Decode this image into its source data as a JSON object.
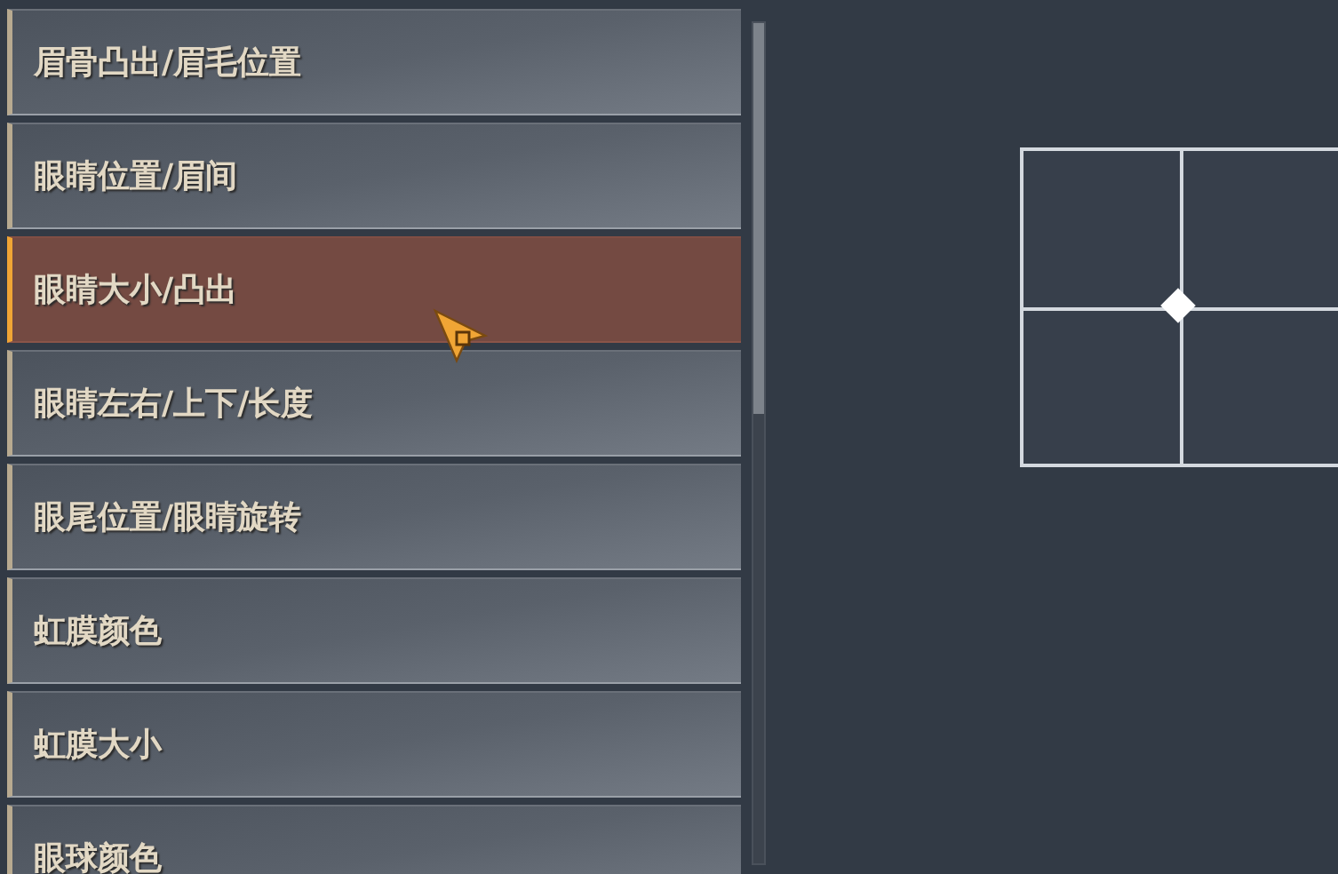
{
  "options": [
    {
      "label": "眉骨凸出/眉毛位置",
      "selected": false
    },
    {
      "label": "眼睛位置/眉间",
      "selected": false
    },
    {
      "label": "眼睛大小/凸出",
      "selected": true
    },
    {
      "label": "眼睛左右/上下/长度",
      "selected": false
    },
    {
      "label": "眼尾位置/眼睛旋转",
      "selected": false
    },
    {
      "label": "虹膜颜色",
      "selected": false
    },
    {
      "label": "虹膜大小",
      "selected": false
    },
    {
      "label": "眼球颜色",
      "selected": false
    }
  ]
}
